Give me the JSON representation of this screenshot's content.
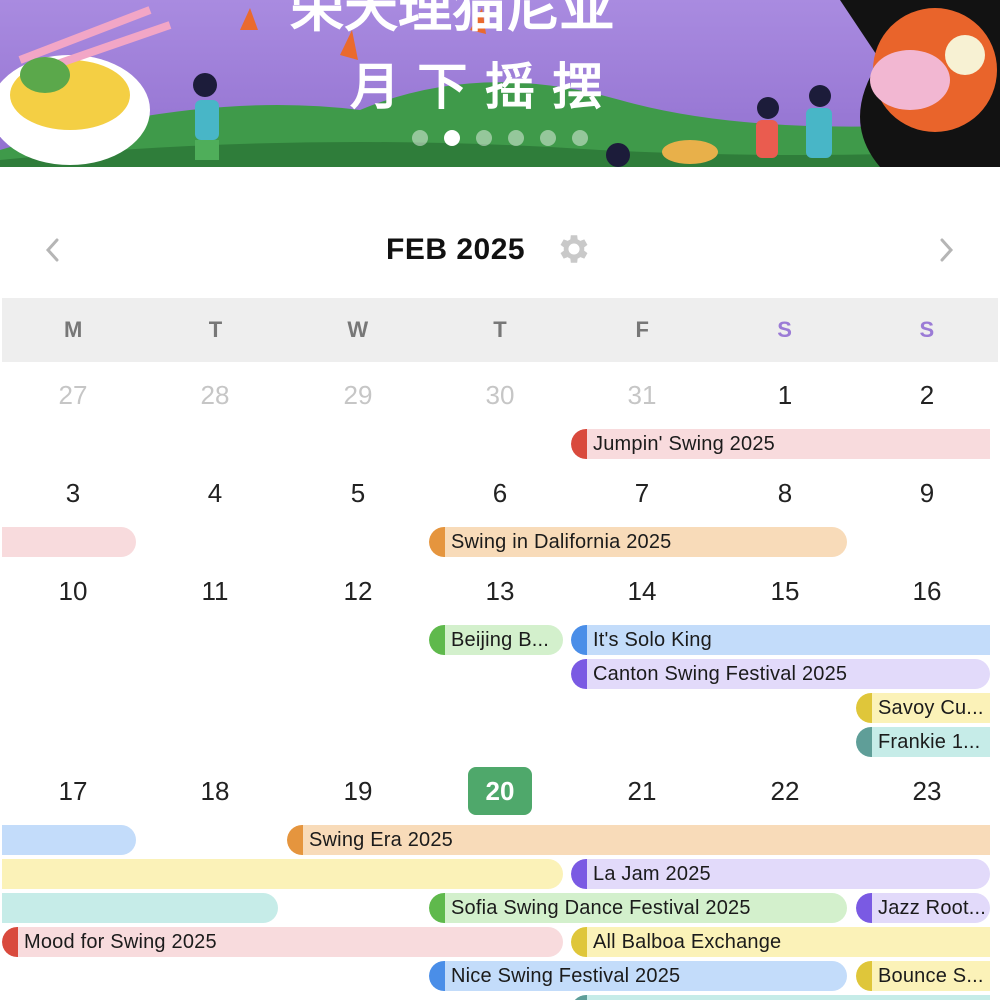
{
  "banner": {
    "title_line1": "荣天理猫尼亚",
    "title_line2": "月 下 摇 摆",
    "carousel_active_index": 1,
    "carousel_count": 6
  },
  "calendar": {
    "month_title": "FEB 2025",
    "prev_icon": "chevron-left-icon",
    "next_icon": "chevron-right-icon",
    "settings_icon": "gear-icon",
    "weekdays": [
      "M",
      "T",
      "W",
      "T",
      "F",
      "S",
      "S"
    ],
    "weekend_color": "#9b7bd6",
    "today_color": "#4fa86b",
    "weeks": [
      [
        "27",
        "28",
        "29",
        "30",
        "31",
        "1",
        "2"
      ],
      [
        "3",
        "4",
        "5",
        "6",
        "7",
        "8",
        "9"
      ],
      [
        "10",
        "11",
        "12",
        "13",
        "14",
        "15",
        "16"
      ],
      [
        "17",
        "18",
        "19",
        "20",
        "21",
        "22",
        "23"
      ]
    ],
    "today": "20"
  },
  "events": {
    "jumpin_swing": "Jumpin' Swing 2025",
    "swing_in_dalifornia": "Swing in Dalifornia 2025",
    "beijing": "Beijing B...",
    "its_solo_king": "It's Solo King",
    "canton_swing": "Canton Swing Festival 2025",
    "savoy": "Savoy Cu...",
    "frankie": "Frankie 1...",
    "swing_era": "Swing Era 2025",
    "la_jam": "La Jam 2025",
    "sofia_swing": "Sofia Swing Dance Festival 2025",
    "jazz_root": "Jazz Root...",
    "mood_for_swing": "Mood for Swing 2025",
    "all_balboa": "All Balboa Exchange",
    "nice_swing": "Nice Swing Festival 2025",
    "bounce": "Bounce S..."
  },
  "colors": {
    "red": "#d94a3d",
    "red_bg": "#f8dbdd",
    "orange": "#e5953e",
    "orange_bg": "#f8dbb9",
    "green": "#5fb94c",
    "green_bg": "#d3f0cc",
    "blue": "#4a8ee8",
    "blue_bg": "#c3dcfa",
    "purple": "#7a5ae3",
    "purple_bg": "#e2dafa",
    "yellow": "#dfc63a",
    "yellow_bg": "#fbf2b8",
    "teal": "#5f9e98",
    "teal_bg": "#c6ece8"
  }
}
